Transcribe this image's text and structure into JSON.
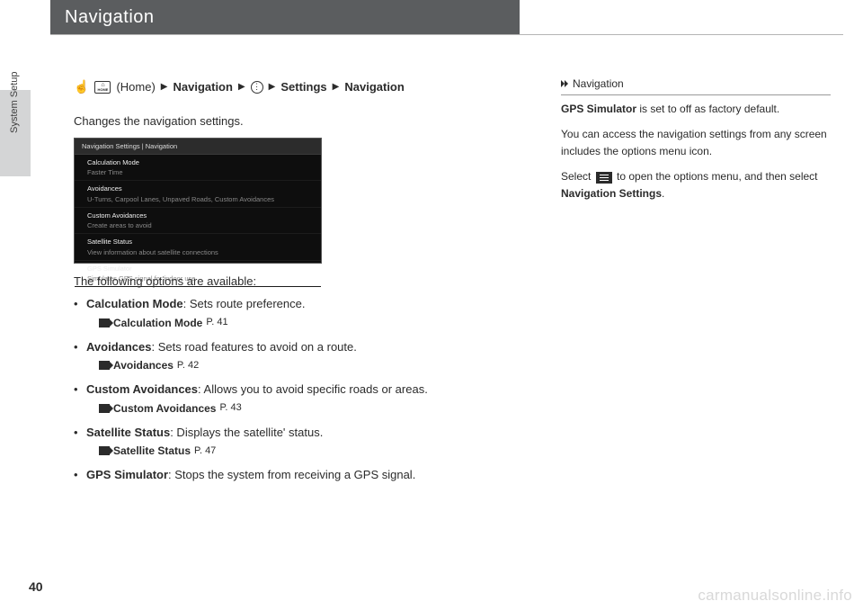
{
  "title": "Navigation",
  "sidetab": "System Setup",
  "breadcrumb": {
    "hand": "☝",
    "home_top": "⌂",
    "home_bottom": "HOME",
    "home_label": "(Home)",
    "nav": "Navigation",
    "dots": "⋮",
    "settings": "Settings",
    "nav2": "Navigation"
  },
  "intro": "Changes the navigation settings.",
  "screenshot": {
    "header": "Navigation Settings   |   Navigation",
    "rows": [
      {
        "t": "Calculation Mode",
        "d": "Faster Time"
      },
      {
        "t": "Avoidances",
        "d": "U-Turns, Carpool Lanes, Unpaved Roads, Custom Avoidances"
      },
      {
        "t": "Custom Avoidances",
        "d": "Create areas to avoid"
      },
      {
        "t": "Satellite Status",
        "d": "View information about satellite connections"
      },
      {
        "t": "GPS Simulator",
        "d": "Simulates GPS signal for indoor use"
      }
    ]
  },
  "opts_intro": "The following options are available:",
  "opts": [
    {
      "name": "Calculation Mode",
      "desc": ": Sets route preference.",
      "xref": "Calculation Mode",
      "page": "P. 41"
    },
    {
      "name": "Avoidances",
      "desc": ": Sets road features to avoid on a route.",
      "xref": "Avoidances",
      "page": "P. 42"
    },
    {
      "name": "Custom Avoidances",
      "desc": ": Allows you to avoid specific roads or areas.",
      "xref": "Custom Avoidances",
      "page": "P. 43"
    },
    {
      "name": "Satellite Status",
      "desc": ": Displays the satellite' status.",
      "xref": "Satellite Status",
      "page": "P. 47"
    },
    {
      "name": "GPS Simulator",
      "desc": ": Stops the system from receiving a GPS signal."
    }
  ],
  "side": {
    "heading": "Navigation",
    "p1a": "GPS Simulator",
    "p1b": " is set to off as factory default.",
    "p2": "You can access the navigation settings from any screen includes the options menu icon.",
    "p3a": "Select ",
    "p3b": " to open the options menu, and then select ",
    "p3c": "Navigation Settings",
    "p3d": "."
  },
  "pagenum": "40",
  "watermark": "carmanualsonline.info"
}
